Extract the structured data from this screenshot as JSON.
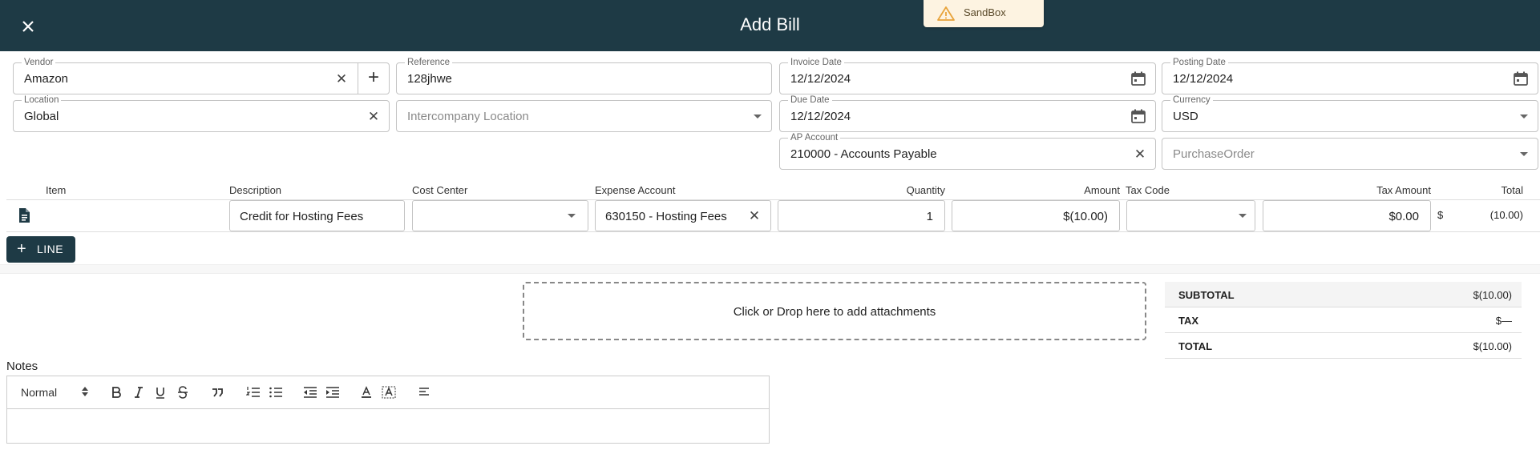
{
  "header": {
    "title": "Add Bill",
    "sandbox_label": "SandBox"
  },
  "form": {
    "vendor": {
      "label": "Vendor",
      "value": "Amazon"
    },
    "reference": {
      "label": "Reference",
      "value": "128jhwe"
    },
    "invoice_date": {
      "label": "Invoice Date",
      "value": "12/12/2024"
    },
    "posting_date": {
      "label": "Posting Date",
      "value": "12/12/2024"
    },
    "location": {
      "label": "Location",
      "value": "Global"
    },
    "intercompany_location": {
      "placeholder": "Intercompany Location"
    },
    "due_date": {
      "label": "Due Date",
      "value": "12/12/2024"
    },
    "currency": {
      "label": "Currency",
      "value": "USD"
    },
    "ap_account": {
      "label": "AP Account",
      "value": "210000 - Accounts Payable"
    },
    "purchase_order": {
      "placeholder": "PurchaseOrder"
    }
  },
  "lines": {
    "headers": {
      "item": "Item",
      "description": "Description",
      "cost_center": "Cost Center",
      "expense_account": "Expense Account",
      "quantity": "Quantity",
      "amount": "Amount",
      "tax_code": "Tax Code",
      "tax_amount": "Tax Amount",
      "total": "Total"
    },
    "rows": [
      {
        "description": "Credit for Hosting Fees",
        "cost_center": "",
        "expense_account": "630150 - Hosting Fees",
        "quantity": "1",
        "amount": "$(10.00)",
        "tax_code": "",
        "tax_amount": "$0.00",
        "total_currency": "$",
        "total": "(10.00)"
      }
    ],
    "add_line_label": "LINE"
  },
  "attachments": {
    "text": "Click or Drop here to add attachments"
  },
  "totals": {
    "subtotal_label": "SUBTOTAL",
    "subtotal": "$(10.00)",
    "tax_label": "TAX",
    "tax": "$—",
    "total_label": "TOTAL",
    "total": "$(10.00)"
  },
  "notes": {
    "label": "Notes",
    "format_value": "Normal"
  },
  "colors": {
    "header_bg": "#1e3a45",
    "sandbox_bg": "#fdf3e1",
    "warning": "#e8a33a"
  },
  "icons": [
    "close-icon",
    "warning-icon",
    "clear-icon",
    "plus-icon",
    "calendar-icon",
    "dropdown-arrow-icon",
    "document-icon",
    "bold-icon",
    "italic-icon",
    "underline-icon",
    "strike-icon",
    "quote-icon",
    "ordered-list-icon",
    "bullet-list-icon",
    "outdent-icon",
    "indent-icon",
    "text-color-icon",
    "highlight-icon",
    "align-icon"
  ]
}
